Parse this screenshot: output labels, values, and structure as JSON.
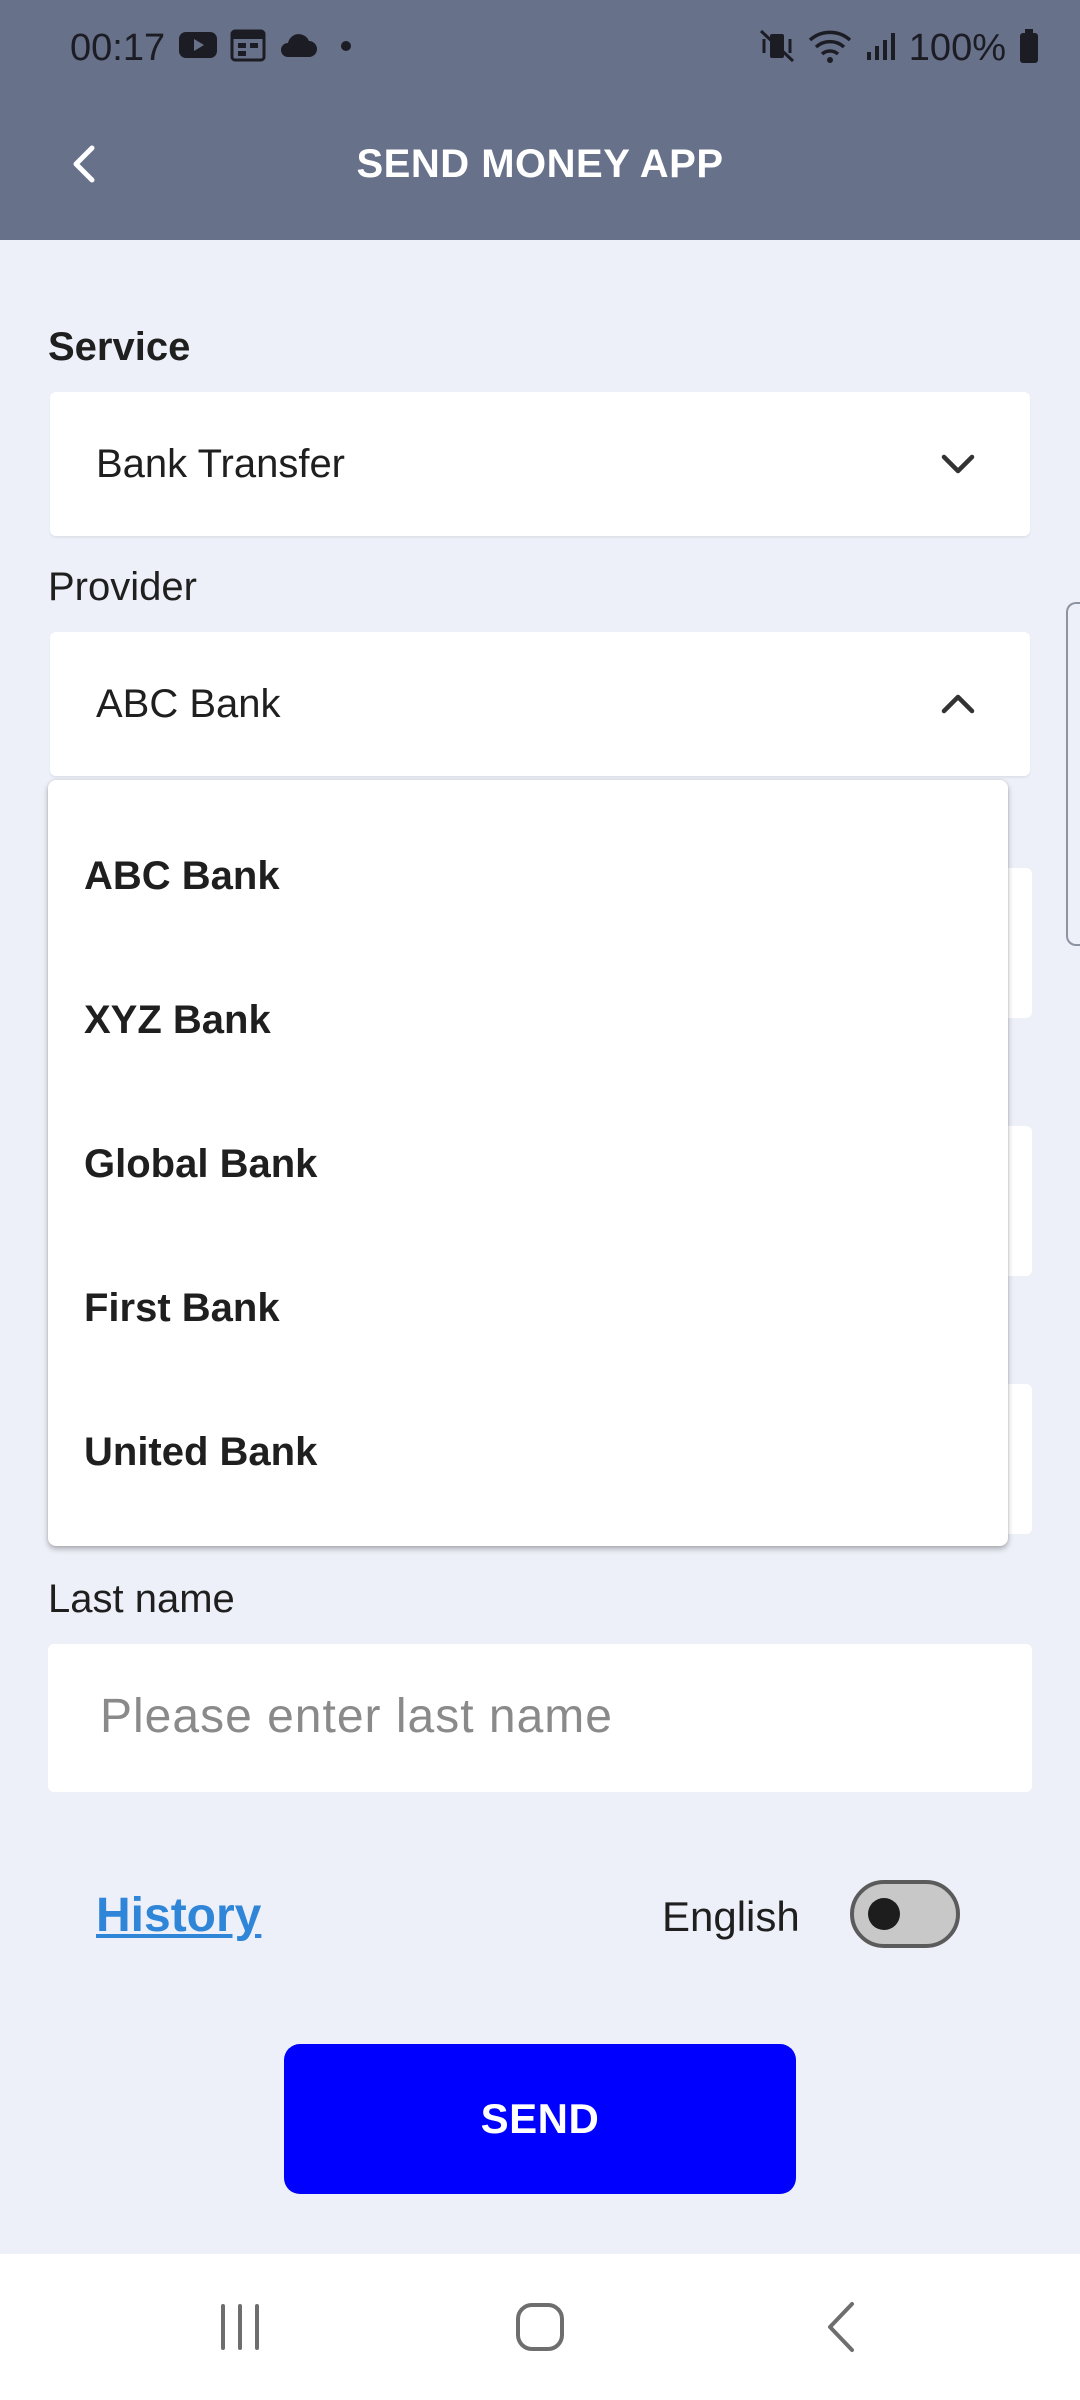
{
  "status_bar": {
    "time": "00:17",
    "left_icons": [
      "youtube-icon",
      "calendar-icon",
      "cloud-icon",
      "dot-icon"
    ],
    "right_icons": [
      "vibrate-icon",
      "wifi-icon",
      "signal-icon",
      "battery-icon"
    ],
    "battery_text": "100%"
  },
  "app_bar": {
    "title": "SEND MONEY APP",
    "back_icon": "back-arrow-icon"
  },
  "form": {
    "service": {
      "label": "Service",
      "value": "Bank Transfer",
      "icon": "chevron-down-icon"
    },
    "provider": {
      "label": "Provider",
      "value": "ABC Bank",
      "icon": "chevron-up-icon",
      "options": [
        "ABC Bank",
        "XYZ Bank",
        "Global Bank",
        "First Bank",
        "United Bank"
      ]
    },
    "last_name": {
      "label": "Last name",
      "placeholder": "Please enter last name",
      "value": ""
    }
  },
  "footer": {
    "history_link": "History",
    "language_label": "English",
    "language_toggle_on": false,
    "send_label": "SEND"
  },
  "nav_bar": {
    "icons": [
      "recents-icon",
      "home-icon",
      "back-icon"
    ]
  },
  "colors": {
    "app_bar": "#68718a",
    "background": "#edf0f8",
    "send_button": "#0000ff",
    "link": "#2f86d9"
  }
}
